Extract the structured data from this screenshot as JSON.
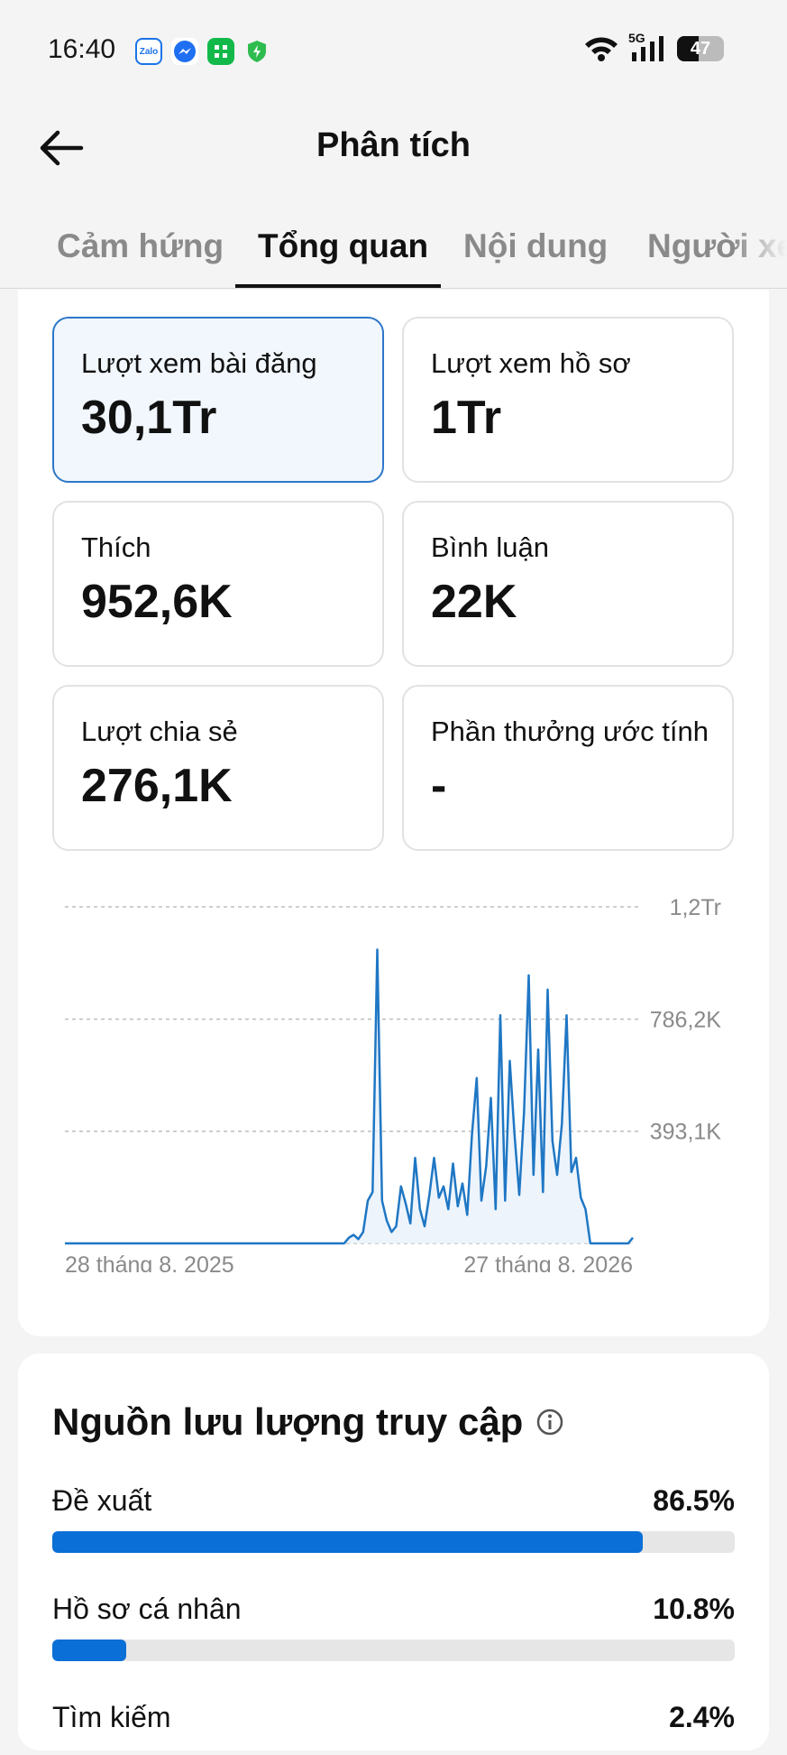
{
  "status": {
    "time": "16:40",
    "apps": [
      {
        "name": "zalo-icon",
        "text": "Zalo"
      },
      {
        "name": "messenger-icon",
        "text": ""
      },
      {
        "name": "green-app-icon",
        "text": ""
      },
      {
        "name": "shield-icon",
        "text": ""
      }
    ],
    "network": "5G",
    "battery": "47",
    "battery_level": 0.47
  },
  "header": {
    "title": "Phân tích",
    "back_icon": "arrow-left-icon"
  },
  "tabs": [
    {
      "label": "Cảm hứng",
      "active": false
    },
    {
      "label": "Tổng quan",
      "active": true
    },
    {
      "label": "Nội dung",
      "active": false
    },
    {
      "label": "Người xem",
      "active": false
    }
  ],
  "metrics": [
    {
      "label": "Lượt xem bài đăng",
      "value": "30,1Tr",
      "selected": true
    },
    {
      "label": "Lượt xem hồ sơ",
      "value": "1Tr",
      "selected": false
    },
    {
      "label": "Thích",
      "value": "952,6K",
      "selected": false
    },
    {
      "label": "Bình luận",
      "value": "22K",
      "selected": false
    },
    {
      "label": "Lượt chia sẻ",
      "value": "276,1K",
      "selected": false
    },
    {
      "label": "Phần thưởng ước tính",
      "value": "-",
      "selected": false
    }
  ],
  "chart_data": {
    "type": "line",
    "title": "",
    "xlabel": "",
    "ylabel": "",
    "y_tick_labels": [
      "1,2Tr",
      "786,2K",
      "393,1K"
    ],
    "y_ticks": [
      1180000,
      786200,
      393100
    ],
    "ylim": [
      0,
      1180000
    ],
    "x_tick_labels": [
      "28 tháng 8, 2025",
      "27 tháng 8, 2026"
    ],
    "color": "#1f77c4",
    "grid": true,
    "x": [
      0,
      1,
      2,
      3,
      4,
      5,
      6,
      7,
      8,
      9,
      10,
      11,
      12,
      13,
      14,
      15,
      16,
      17,
      18,
      19,
      20,
      21,
      22,
      23,
      24,
      25,
      26,
      27,
      28,
      29,
      30,
      31,
      32,
      33,
      34,
      35,
      36,
      37,
      38,
      39,
      40,
      41,
      42,
      43,
      44,
      45,
      46,
      47,
      48,
      49,
      50,
      51,
      52,
      53,
      54,
      55,
      56,
      57,
      58,
      59,
      60,
      61,
      62,
      63,
      64,
      65,
      66,
      67,
      68,
      69,
      70,
      71,
      72,
      73,
      74,
      75,
      76,
      77,
      78,
      79,
      80,
      81,
      82,
      83,
      84,
      85,
      86,
      87,
      88,
      89,
      90,
      91,
      92,
      93,
      94,
      95,
      96,
      97,
      98,
      99,
      100,
      101,
      102,
      103,
      104,
      105,
      106,
      107,
      108,
      109,
      110,
      111,
      112,
      113,
      114,
      115,
      116,
      117,
      118,
      119,
      120
    ],
    "series": [
      {
        "values": [
          0,
          0,
          0,
          0,
          0,
          0,
          0,
          0,
          0,
          0,
          0,
          0,
          0,
          0,
          0,
          0,
          0,
          0,
          0,
          0,
          0,
          0,
          0,
          0,
          0,
          0,
          0,
          0,
          0,
          0,
          0,
          0,
          0,
          0,
          0,
          0,
          0,
          0,
          0,
          0,
          0,
          0,
          0,
          0,
          0,
          0,
          0,
          0,
          0,
          0,
          0,
          0,
          0,
          0,
          0,
          0,
          0,
          0,
          0,
          0,
          20000,
          30000,
          15000,
          40000,
          150000,
          180000,
          1030000,
          150000,
          80000,
          40000,
          60000,
          200000,
          140000,
          70000,
          300000,
          120000,
          60000,
          170000,
          300000,
          160000,
          200000,
          120000,
          280000,
          130000,
          210000,
          100000,
          380000,
          580000,
          150000,
          270000,
          510000,
          120000,
          800000,
          150000,
          640000,
          380000,
          170000,
          460000,
          940000,
          240000,
          680000,
          180000,
          890000,
          360000,
          240000,
          420000,
          800000,
          250000,
          300000,
          160000,
          120000,
          0,
          0,
          0,
          0,
          0,
          0,
          0,
          0,
          0,
          20000
        ]
      }
    ]
  },
  "traffic": {
    "title": "Nguồn lưu lượng truy cập",
    "info_icon": "info-icon",
    "sources": [
      {
        "label": "Đề xuất",
        "pct": "86.5%",
        "value": 86.5
      },
      {
        "label": "Hồ sơ cá nhân",
        "pct": "10.8%",
        "value": 10.8
      },
      {
        "label": "Tìm kiếm",
        "pct": "2.4%",
        "value": 2.4
      }
    ]
  }
}
